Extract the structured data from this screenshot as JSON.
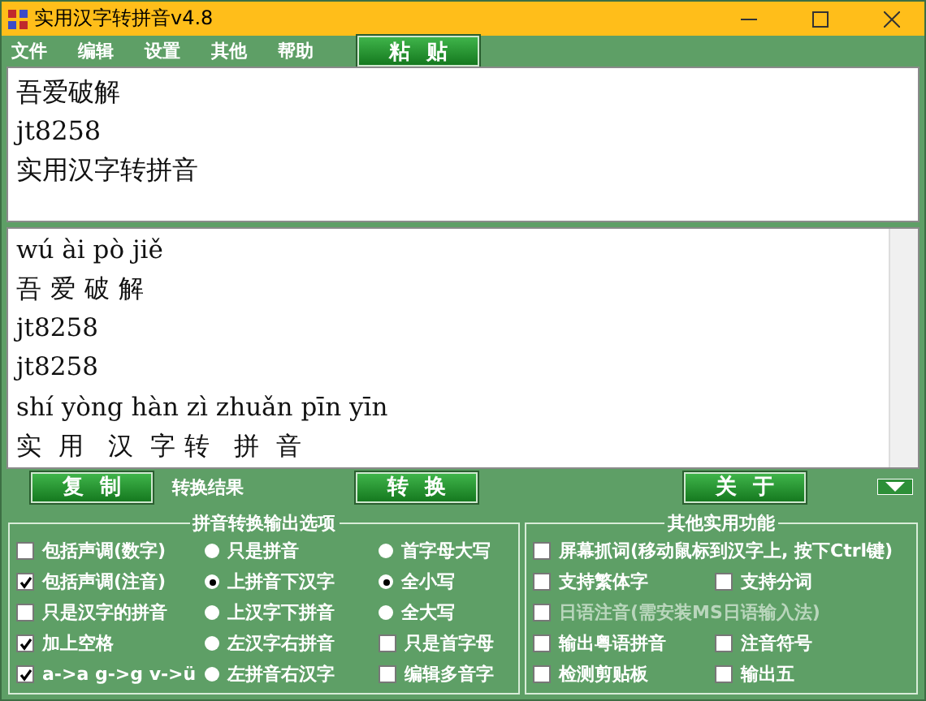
{
  "window": {
    "title": "实用汉字转拼音v4.8"
  },
  "menu": [
    "文件",
    "编辑",
    "设置",
    "其他",
    "帮助"
  ],
  "paste_button": "粘贴",
  "input_lines": [
    "吾爱破解",
    "jt8258",
    "实用汉字转拼音"
  ],
  "output_lines": [
    "wú ài pò jiě",
    "吾 爱 破 解",
    "jt8258",
    "jt8258",
    "shí yòng hàn zì zhuǎn pīn yīn",
    "实  用   汉  字 转   拼  音"
  ],
  "copy_button": "复制",
  "result_label": "转换结果",
  "convert_button": "转换",
  "about_button": "关于",
  "output_options": {
    "title": "拼音转换输出选项",
    "columns": [
      [
        {
          "kind": "checkbox",
          "label": "包括声调(数字)",
          "checked": false
        },
        {
          "kind": "checkbox",
          "label": "包括声调(注音)",
          "checked": true
        },
        {
          "kind": "checkbox",
          "label": "只是汉字的拼音",
          "checked": false
        },
        {
          "kind": "checkbox",
          "label": "加上空格",
          "checked": true
        },
        {
          "kind": "checkbox",
          "label": "a->a g->g v->ü",
          "checked": true
        }
      ],
      [
        {
          "kind": "radio",
          "label": "只是拼音",
          "selected": false
        },
        {
          "kind": "radio",
          "label": "上拼音下汉字",
          "selected": true
        },
        {
          "kind": "radio",
          "label": "上汉字下拼音",
          "selected": false
        },
        {
          "kind": "radio",
          "label": "左汉字右拼音",
          "selected": false
        },
        {
          "kind": "radio",
          "label": "左拼音右汉字",
          "selected": false
        }
      ],
      [
        {
          "kind": "radio",
          "label": "首字母大写",
          "selected": false
        },
        {
          "kind": "radio",
          "label": "全小写",
          "selected": true
        },
        {
          "kind": "radio",
          "label": "全大写",
          "selected": false
        },
        {
          "kind": "checkbox",
          "label": "只是首字母",
          "checked": false
        },
        {
          "kind": "checkbox",
          "label": "编辑多音字",
          "checked": false
        }
      ]
    ]
  },
  "other_functions": {
    "title": "其他实用功能",
    "rows": [
      [
        {
          "label": "屏幕抓词(移动鼠标到汉字上, 按下Ctrl键)",
          "checked": false,
          "disabled": false
        }
      ],
      [
        {
          "label": "支持繁体字",
          "checked": false,
          "disabled": false
        },
        {
          "label": "支持分词",
          "checked": false,
          "disabled": false
        }
      ],
      [
        {
          "label": "日语注音(需安装MS日语输入法)",
          "checked": false,
          "disabled": true
        }
      ],
      [
        {
          "label": "输出粤语拼音",
          "checked": false,
          "disabled": false
        },
        {
          "label": "注音符号",
          "checked": false,
          "disabled": false
        }
      ],
      [
        {
          "label": "检测剪贴板",
          "checked": false,
          "disabled": false
        },
        {
          "label": "输出五",
          "checked": false,
          "disabled": false
        }
      ]
    ]
  }
}
